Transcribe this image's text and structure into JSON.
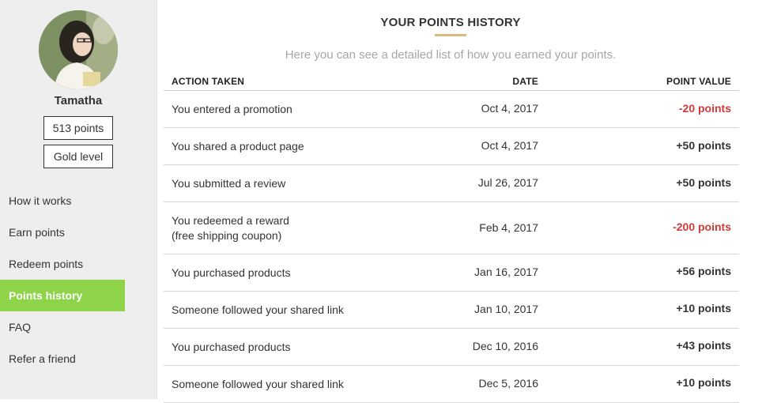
{
  "user": {
    "name": "Tamatha",
    "points": "513 points",
    "level": "Gold level"
  },
  "nav": {
    "items": [
      {
        "label": "How it works",
        "active": false
      },
      {
        "label": "Earn points",
        "active": false
      },
      {
        "label": "Redeem points",
        "active": false
      },
      {
        "label": "Points history",
        "active": true
      },
      {
        "label": "FAQ",
        "active": false
      },
      {
        "label": "Refer a friend",
        "active": false
      }
    ]
  },
  "main": {
    "title": "YOUR POINTS HISTORY",
    "subtitle": "Here you can see a detailed list of how you earned your points.",
    "columns": {
      "action": "ACTION TAKEN",
      "date": "DATE",
      "value": "POINT VALUE"
    },
    "rows": [
      {
        "action": "You entered a promotion",
        "action2": "",
        "date": "Oct 4, 2017",
        "value": "-20 points",
        "negative": true
      },
      {
        "action": "You shared a product page",
        "action2": "",
        "date": "Oct 4, 2017",
        "value": "+50 points",
        "negative": false
      },
      {
        "action": "You submitted a review",
        "action2": "",
        "date": "Jul 26, 2017",
        "value": "+50 points",
        "negative": false
      },
      {
        "action": "You redeemed a reward",
        "action2": "(free shipping coupon)",
        "date": "Feb 4, 2017",
        "value": "-200 points",
        "negative": true
      },
      {
        "action": "You purchased products",
        "action2": "",
        "date": "Jan 16, 2017",
        "value": "+56 points",
        "negative": false
      },
      {
        "action": "Someone followed your shared link",
        "action2": "",
        "date": "Jan 10, 2017",
        "value": "+10 points",
        "negative": false
      },
      {
        "action": "You purchased products",
        "action2": "",
        "date": "Dec 10, 2016",
        "value": "+43 points",
        "negative": false
      },
      {
        "action": "Someone followed your shared link",
        "action2": "",
        "date": "Dec 5, 2016",
        "value": "+10 points",
        "negative": false
      }
    ]
  },
  "colors": {
    "accent_green": "#8ed448",
    "negative_red": "#d03a3a",
    "title_underline": "#d6bb7c",
    "sidebar_bg": "#eeeeee"
  }
}
